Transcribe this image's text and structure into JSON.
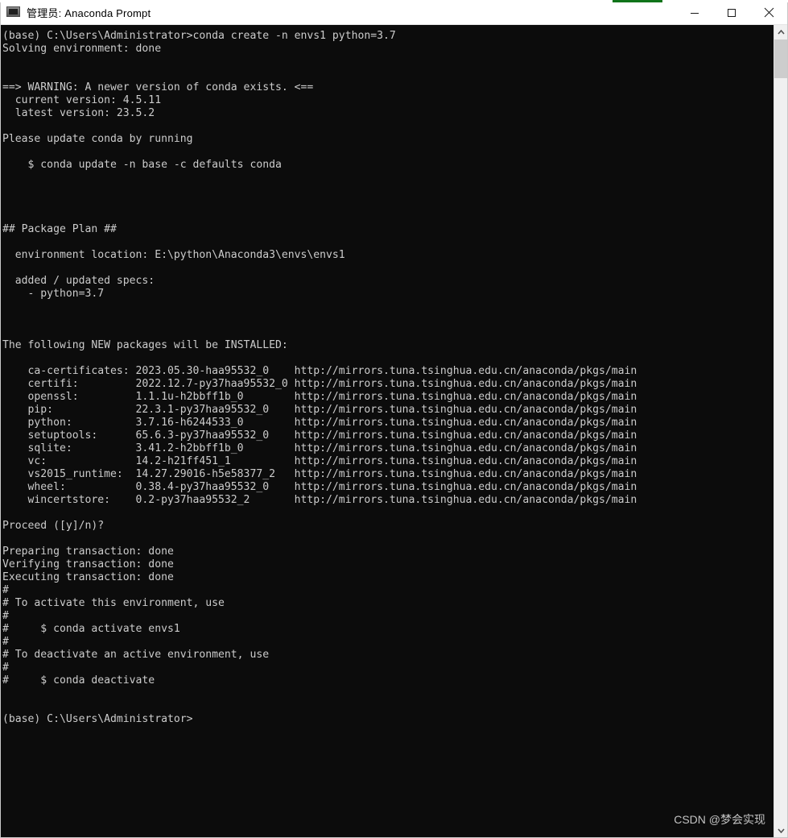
{
  "window": {
    "title": "管理员: Anaconda Prompt",
    "icon": "console-icon",
    "accent_green": "#10741a",
    "bg": "#0c0c0c",
    "fg": "#cccccc",
    "titlebar_bg": "#ffffff",
    "buttons": {
      "minimize": "minimize",
      "maximize": "maximize",
      "close": "close"
    }
  },
  "terminal": {
    "lines": [
      "(base) C:\\Users\\Administrator>conda create -n envs1 python=3.7",
      "Solving environment: done",
      "",
      "",
      "==> WARNING: A newer version of conda exists. <==",
      "  current version: 4.5.11",
      "  latest version: 23.5.2",
      "",
      "Please update conda by running",
      "",
      "    $ conda update -n base -c defaults conda",
      "",
      "",
      "",
      "",
      "## Package Plan ##",
      "",
      "  environment location: E:\\python\\Anaconda3\\envs\\envs1",
      "",
      "  added / updated specs:",
      "    - python=3.7",
      "",
      "",
      "",
      "The following NEW packages will be INSTALLED:",
      "",
      "    ca-certificates: 2023.05.30-haa95532_0    http://mirrors.tuna.tsinghua.edu.cn/anaconda/pkgs/main",
      "    certifi:         2022.12.7-py37haa95532_0 http://mirrors.tuna.tsinghua.edu.cn/anaconda/pkgs/main",
      "    openssl:         1.1.1u-h2bbff1b_0        http://mirrors.tuna.tsinghua.edu.cn/anaconda/pkgs/main",
      "    pip:             22.3.1-py37haa95532_0    http://mirrors.tuna.tsinghua.edu.cn/anaconda/pkgs/main",
      "    python:          3.7.16-h6244533_0        http://mirrors.tuna.tsinghua.edu.cn/anaconda/pkgs/main",
      "    setuptools:      65.6.3-py37haa95532_0    http://mirrors.tuna.tsinghua.edu.cn/anaconda/pkgs/main",
      "    sqlite:          3.41.2-h2bbff1b_0        http://mirrors.tuna.tsinghua.edu.cn/anaconda/pkgs/main",
      "    vc:              14.2-h21ff451_1          http://mirrors.tuna.tsinghua.edu.cn/anaconda/pkgs/main",
      "    vs2015_runtime:  14.27.29016-h5e58377_2   http://mirrors.tuna.tsinghua.edu.cn/anaconda/pkgs/main",
      "    wheel:           0.38.4-py37haa95532_0    http://mirrors.tuna.tsinghua.edu.cn/anaconda/pkgs/main",
      "    wincertstore:    0.2-py37haa95532_2       http://mirrors.tuna.tsinghua.edu.cn/anaconda/pkgs/main",
      "",
      "Proceed ([y]/n)?",
      "",
      "Preparing transaction: done",
      "Verifying transaction: done",
      "Executing transaction: done",
      "#",
      "# To activate this environment, use",
      "#",
      "#     $ conda activate envs1",
      "#",
      "# To deactivate an active environment, use",
      "#",
      "#     $ conda deactivate",
      "",
      "",
      "(base) C:\\Users\\Administrator>"
    ]
  },
  "watermark": {
    "text": "CSDN @梦会实现"
  },
  "scrollbar": {
    "up_arrow": "chevron-up-icon",
    "down_arrow": "chevron-down-icon"
  }
}
